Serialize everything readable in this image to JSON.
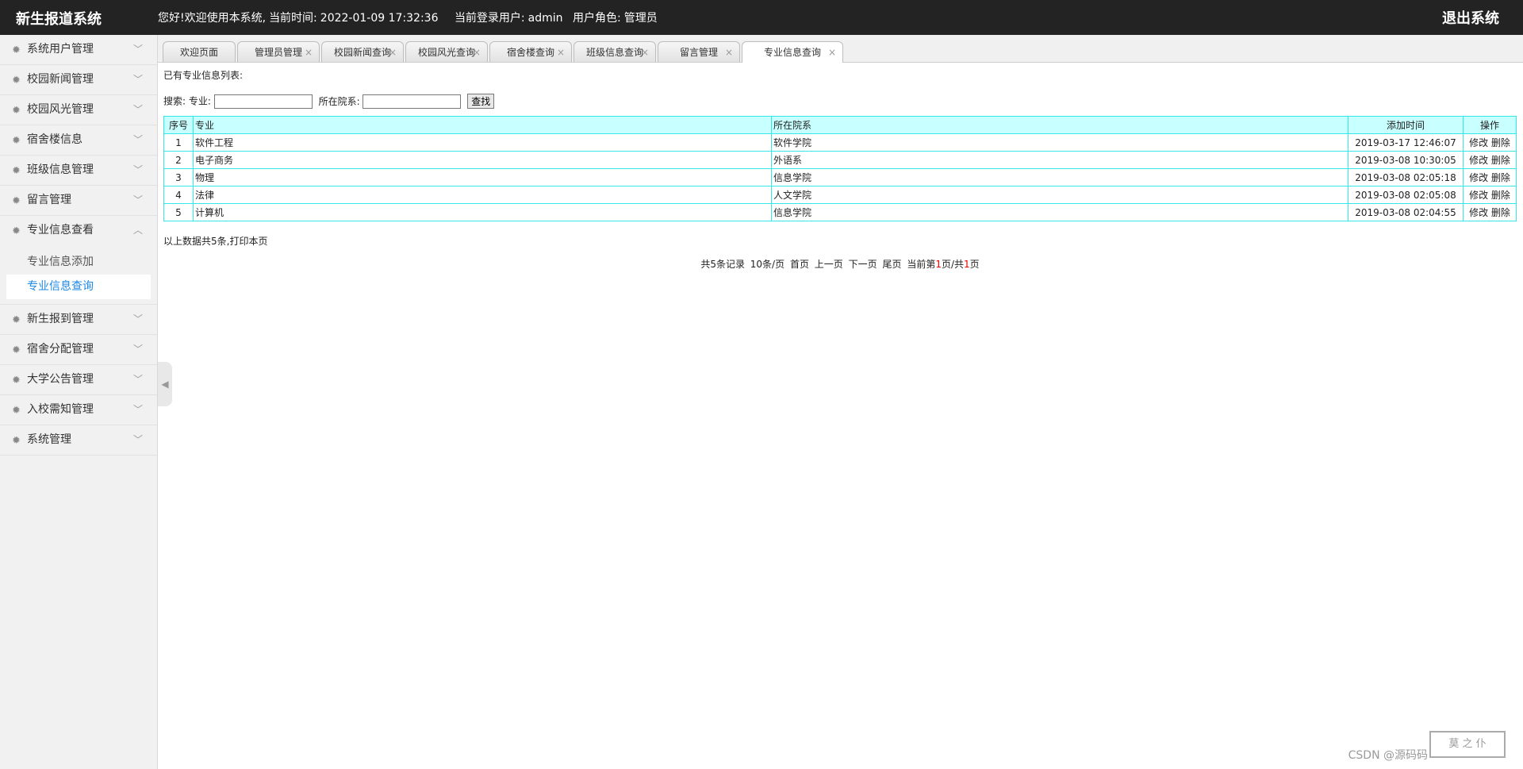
{
  "header": {
    "title": "新生报道系统",
    "greeting": "您好!欢迎使用本系统,",
    "time_label": "当前时间:",
    "time_value": "2022-01-09 17:32:36",
    "user_label": "当前登录用户:",
    "user_value": "admin",
    "role_label": "用户角色:",
    "role_value": "管理员",
    "logout": "退出系统"
  },
  "sidebar": {
    "items": [
      {
        "label": "系统用户管理"
      },
      {
        "label": "校园新闻管理"
      },
      {
        "label": "校园风光管理"
      },
      {
        "label": "宿舍楼信息"
      },
      {
        "label": "班级信息管理"
      },
      {
        "label": "留言管理"
      },
      {
        "label": "专业信息查看",
        "expanded": true
      },
      {
        "label": "新生报到管理"
      },
      {
        "label": "宿舍分配管理"
      },
      {
        "label": "大学公告管理"
      },
      {
        "label": "入校需知管理"
      },
      {
        "label": "系统管理"
      }
    ],
    "sub": [
      {
        "label": "专业信息添加"
      },
      {
        "label": "专业信息查询",
        "active": true
      }
    ]
  },
  "tabs": [
    {
      "label": "欢迎页面"
    },
    {
      "label": "管理员管理"
    },
    {
      "label": "校园新闻查询"
    },
    {
      "label": "校园风光查询"
    },
    {
      "label": "宿舍楼查询"
    },
    {
      "label": "班级信息查询"
    },
    {
      "label": "留言管理"
    },
    {
      "label": "专业信息查询",
      "active": true
    }
  ],
  "main": {
    "caption": "已有专业信息列表:",
    "search": {
      "prefix": "搜索:",
      "major_label": "专业:",
      "major_value": "",
      "dept_label": "所在院系:",
      "dept_value": "",
      "button": "查找"
    },
    "table": {
      "headers": [
        "序号",
        "专业",
        "所在院系",
        "添加时间",
        "操作"
      ],
      "rows": [
        {
          "no": "1",
          "major": "软件工程",
          "dept": "软件学院",
          "time": "2019-03-17 12:46:07"
        },
        {
          "no": "2",
          "major": "电子商务",
          "dept": "外语系",
          "time": "2019-03-08 10:30:05"
        },
        {
          "no": "3",
          "major": "物理",
          "dept": "信息学院",
          "time": "2019-03-08 02:05:18"
        },
        {
          "no": "4",
          "major": "法律",
          "dept": "人文学院",
          "time": "2019-03-08 02:05:08"
        },
        {
          "no": "5",
          "major": "计算机",
          "dept": "信息学院",
          "time": "2019-03-08 02:04:55"
        }
      ],
      "edit": "修改",
      "delete": "删除"
    },
    "summary": "以上数据共5条,打印本页",
    "pager": {
      "total": "共5条记录",
      "per_page": "10条/页",
      "first": "首页",
      "prev": "上一页",
      "next": "下一页",
      "last": "尾页",
      "current_prefix": "当前第",
      "current": "1",
      "sep": "页/共",
      "pages": "1",
      "suffix": "页"
    }
  },
  "watermark": "CSDN @源码码",
  "stamp": "莫 之 仆"
}
